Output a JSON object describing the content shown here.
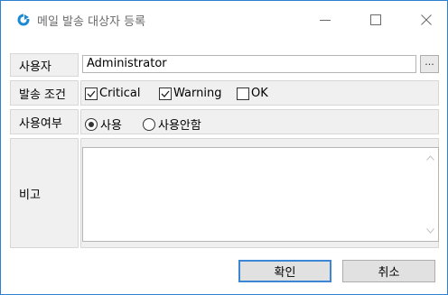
{
  "window": {
    "title": "메일 발송 대상자 등록",
    "accent_color": "#2d7fd0",
    "icon": "refresh-icon"
  },
  "form": {
    "user": {
      "label": "사용자",
      "value": "Administrator",
      "browse_label": "..."
    },
    "send_condition": {
      "label": "발송 조건",
      "options": [
        {
          "label": "Critical",
          "checked": true
        },
        {
          "label": "Warning",
          "checked": true
        },
        {
          "label": "OK",
          "checked": false
        }
      ]
    },
    "usage": {
      "label": "사용여부",
      "options": [
        {
          "label": "사용",
          "selected": true
        },
        {
          "label": "사용안함",
          "selected": false
        }
      ]
    },
    "remarks": {
      "label": "비고",
      "value": ""
    }
  },
  "buttons": {
    "confirm": "확인",
    "cancel": "취소"
  }
}
